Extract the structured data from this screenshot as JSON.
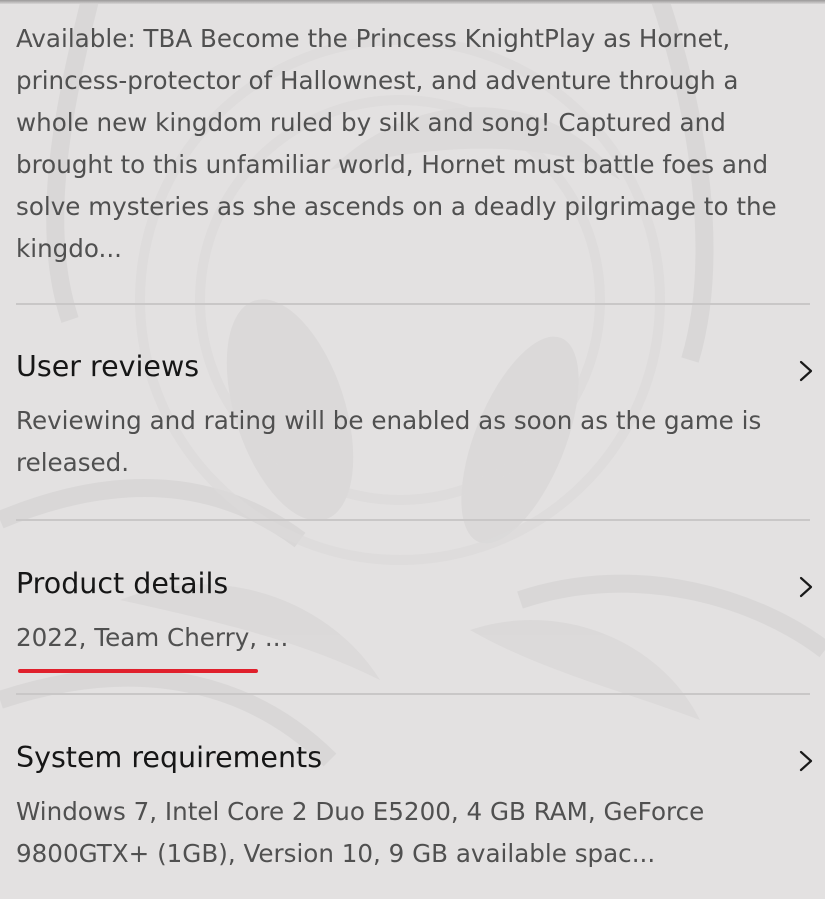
{
  "description": {
    "text": "Available: TBA Become the Princess KnightPlay as Hornet, princess-protector of Hallownest, and adventure through a whole new kingdom ruled by silk and song! Captured and brought to this unfamiliar world, Hornet must battle foes and solve mysteries as she ascends on a deadly pilgrimage to the kingdo..."
  },
  "sections": [
    {
      "title": "User reviews",
      "subtitle": "Reviewing and rating will be enabled as soon as the game is released.",
      "icon": "chevron-right-icon"
    },
    {
      "title": "Product details",
      "subtitle": "2022, Team Cherry, ...",
      "icon": "chevron-right-icon"
    },
    {
      "title": "System requirements",
      "subtitle": "Windows 7, Intel Core 2 Duo E5200, 4 GB RAM, GeForce 9800GTX+ (1GB), Version 10, 9 GB available spac...",
      "icon": "chevron-right-icon"
    }
  ],
  "colors": {
    "background": "#e3e1e1",
    "highlight_underline": "#e0202c",
    "text_primary": "#161616",
    "text_secondary": "#505050"
  }
}
